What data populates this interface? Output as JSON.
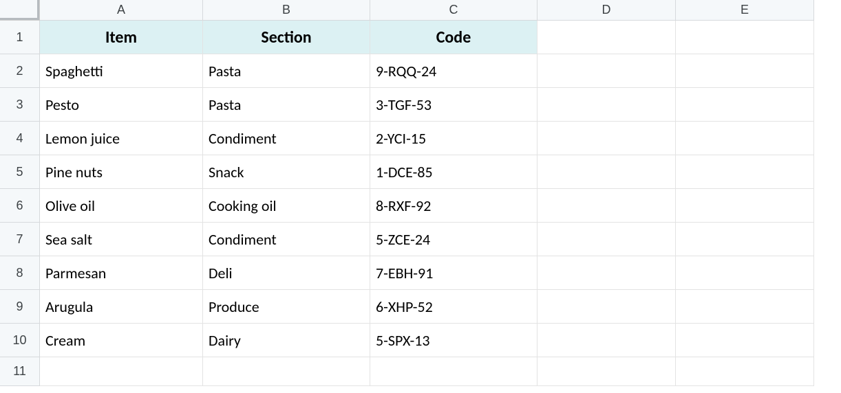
{
  "columns": [
    "A",
    "B",
    "C",
    "D",
    "E"
  ],
  "rowNumbers": [
    "1",
    "2",
    "3",
    "4",
    "5",
    "6",
    "7",
    "8",
    "9",
    "10",
    "11"
  ],
  "headers": {
    "item": "Item",
    "section": "Section",
    "code": "Code"
  },
  "rows": [
    {
      "item": "Spaghetti",
      "section": "Pasta",
      "code": "9-RQQ-24"
    },
    {
      "item": "Pesto",
      "section": "Pasta",
      "code": "3-TGF-53"
    },
    {
      "item": "Lemon juice",
      "section": "Condiment",
      "code": "2-YCI-15"
    },
    {
      "item": "Pine nuts",
      "section": "Snack",
      "code": "1-DCE-85"
    },
    {
      "item": "Olive oil",
      "section": "Cooking oil",
      "code": "8-RXF-92"
    },
    {
      "item": "Sea salt",
      "section": "Condiment",
      "code": "5-ZCE-24"
    },
    {
      "item": "Parmesan",
      "section": "Deli",
      "code": "7-EBH-91"
    },
    {
      "item": "Arugula",
      "section": "Produce",
      "code": "6-XHP-52"
    },
    {
      "item": "Cream",
      "section": "Dairy",
      "code": "5-SPX-13"
    }
  ],
  "chart_data": {
    "type": "table",
    "title": "",
    "columns": [
      "Item",
      "Section",
      "Code"
    ],
    "rows": [
      [
        "Spaghetti",
        "Pasta",
        "9-RQQ-24"
      ],
      [
        "Pesto",
        "Pasta",
        "3-TGF-53"
      ],
      [
        "Lemon juice",
        "Condiment",
        "2-YCI-15"
      ],
      [
        "Pine nuts",
        "Snack",
        "1-DCE-85"
      ],
      [
        "Olive oil",
        "Cooking oil",
        "8-RXF-92"
      ],
      [
        "Sea salt",
        "Condiment",
        "5-ZCE-24"
      ],
      [
        "Parmesan",
        "Deli",
        "7-EBH-91"
      ],
      [
        "Arugula",
        "Produce",
        "6-XHP-52"
      ],
      [
        "Cream",
        "Dairy",
        "5-SPX-13"
      ]
    ]
  }
}
